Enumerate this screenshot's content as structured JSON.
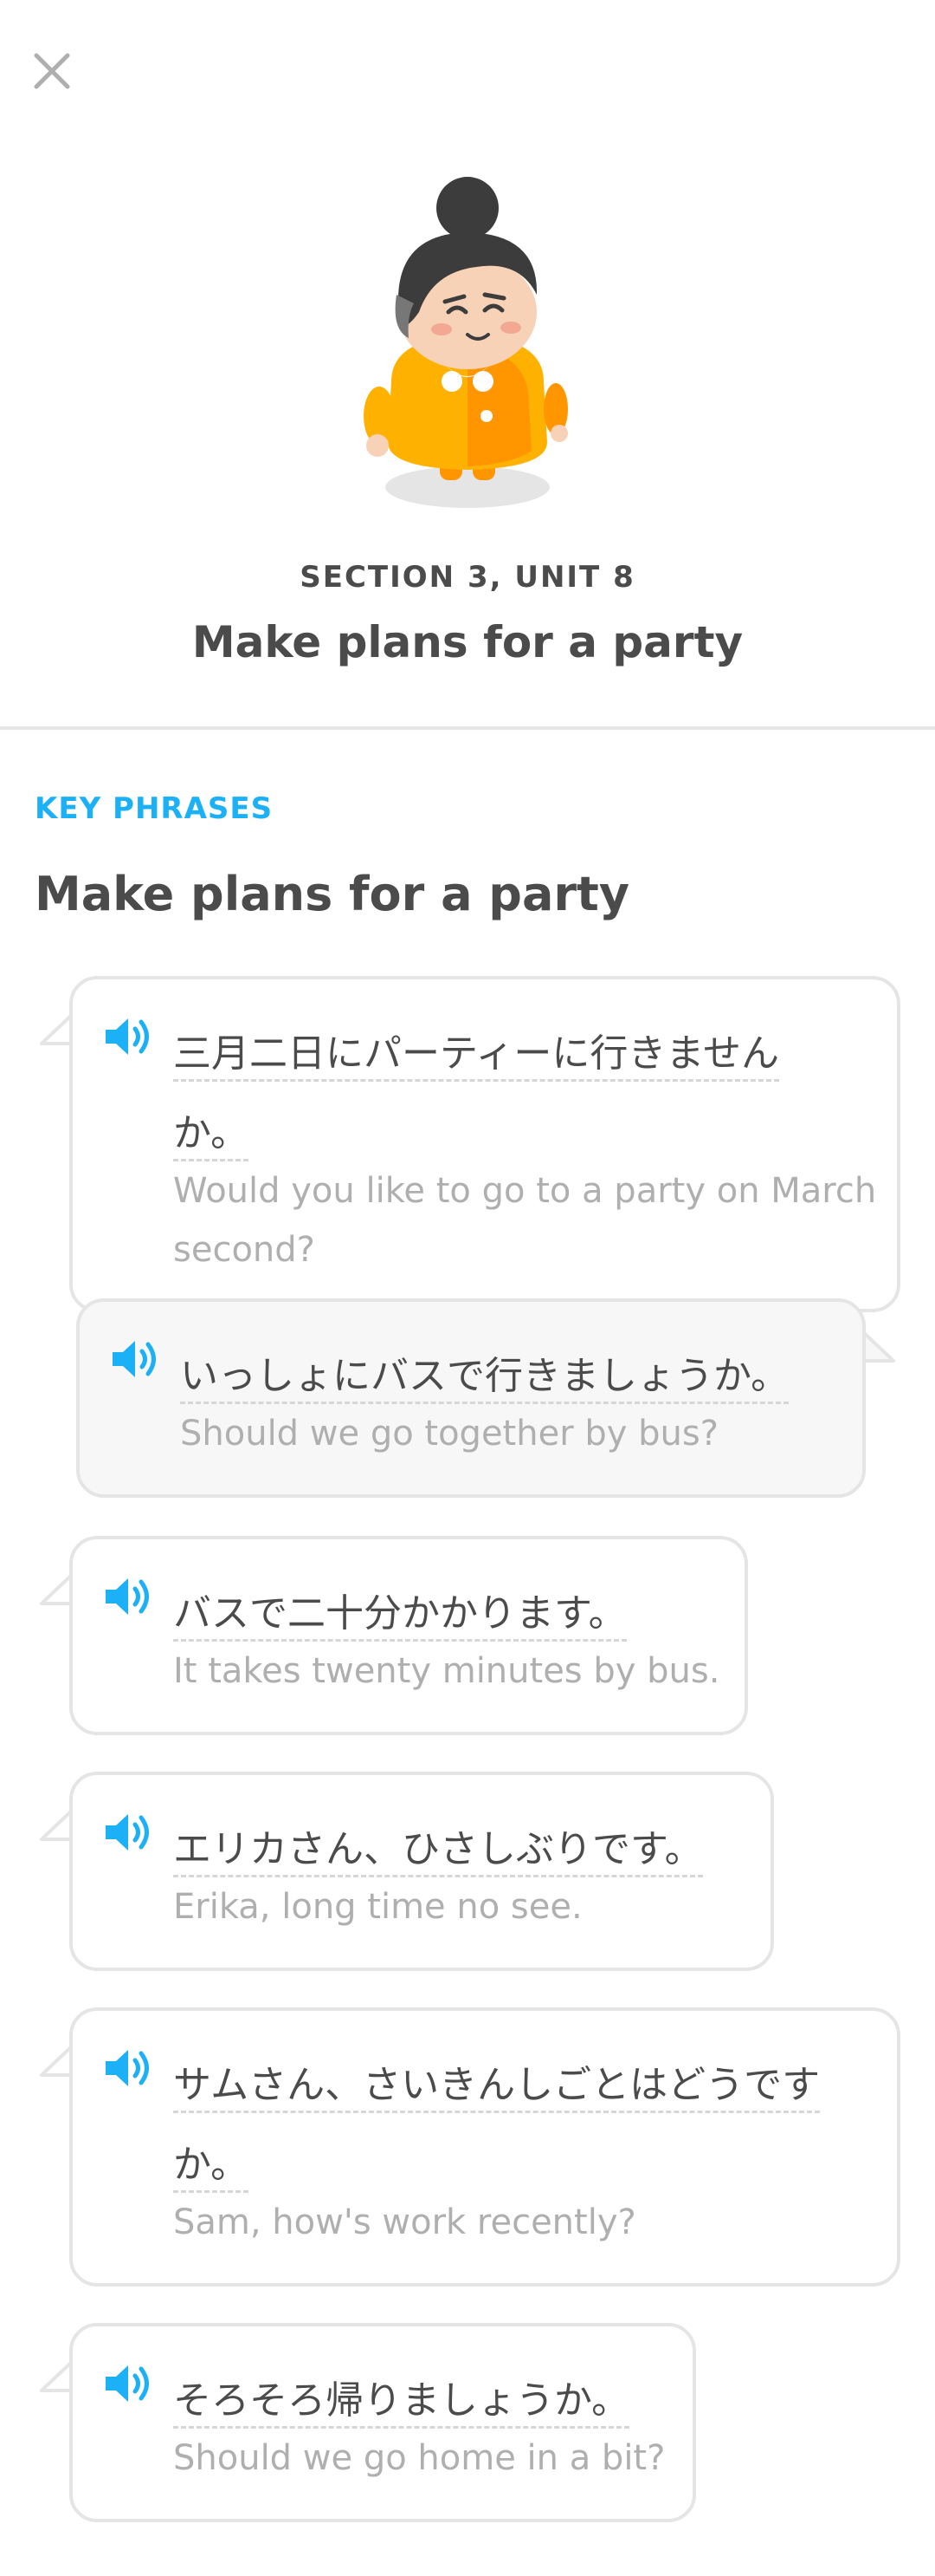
{
  "header": {
    "section_label": "SECTION 3, UNIT 8",
    "title": "Make plans for a party"
  },
  "content": {
    "kicker": "KEY PHRASES",
    "title": "Make plans for a party"
  },
  "colors": {
    "accent": "#1cb0f6",
    "text": "#4b4b4b",
    "muted": "#afafaf",
    "border": "#e5e5e5"
  },
  "icons": {
    "close": "close-icon",
    "speaker": "speaker-icon"
  },
  "phrases": [
    {
      "jp_line1": "三月二日にパーティーに行きません",
      "jp_line2": "か。",
      "en_line1": "Would you like to go to a party on March",
      "en_line2": "second?"
    },
    {
      "jp_line1": "いっしょにバスで行きましょうか。",
      "en_line1": "Should we go together by bus?"
    },
    {
      "jp_line1": "バスで二十分かかります。",
      "en_line1": "It takes twenty minutes by bus."
    },
    {
      "jp_line1": "エリカさん、ひさしぶりです。",
      "en_line1": "Erika, long time no see."
    },
    {
      "jp_line1": "サムさん、さいきんしごとはどうです",
      "jp_line2": "か。",
      "en_line1": "Sam, how's work recently?"
    },
    {
      "jp_line1": "そろそろ帰りましょうか。",
      "en_line1": "Should we go home in a bit?"
    }
  ]
}
